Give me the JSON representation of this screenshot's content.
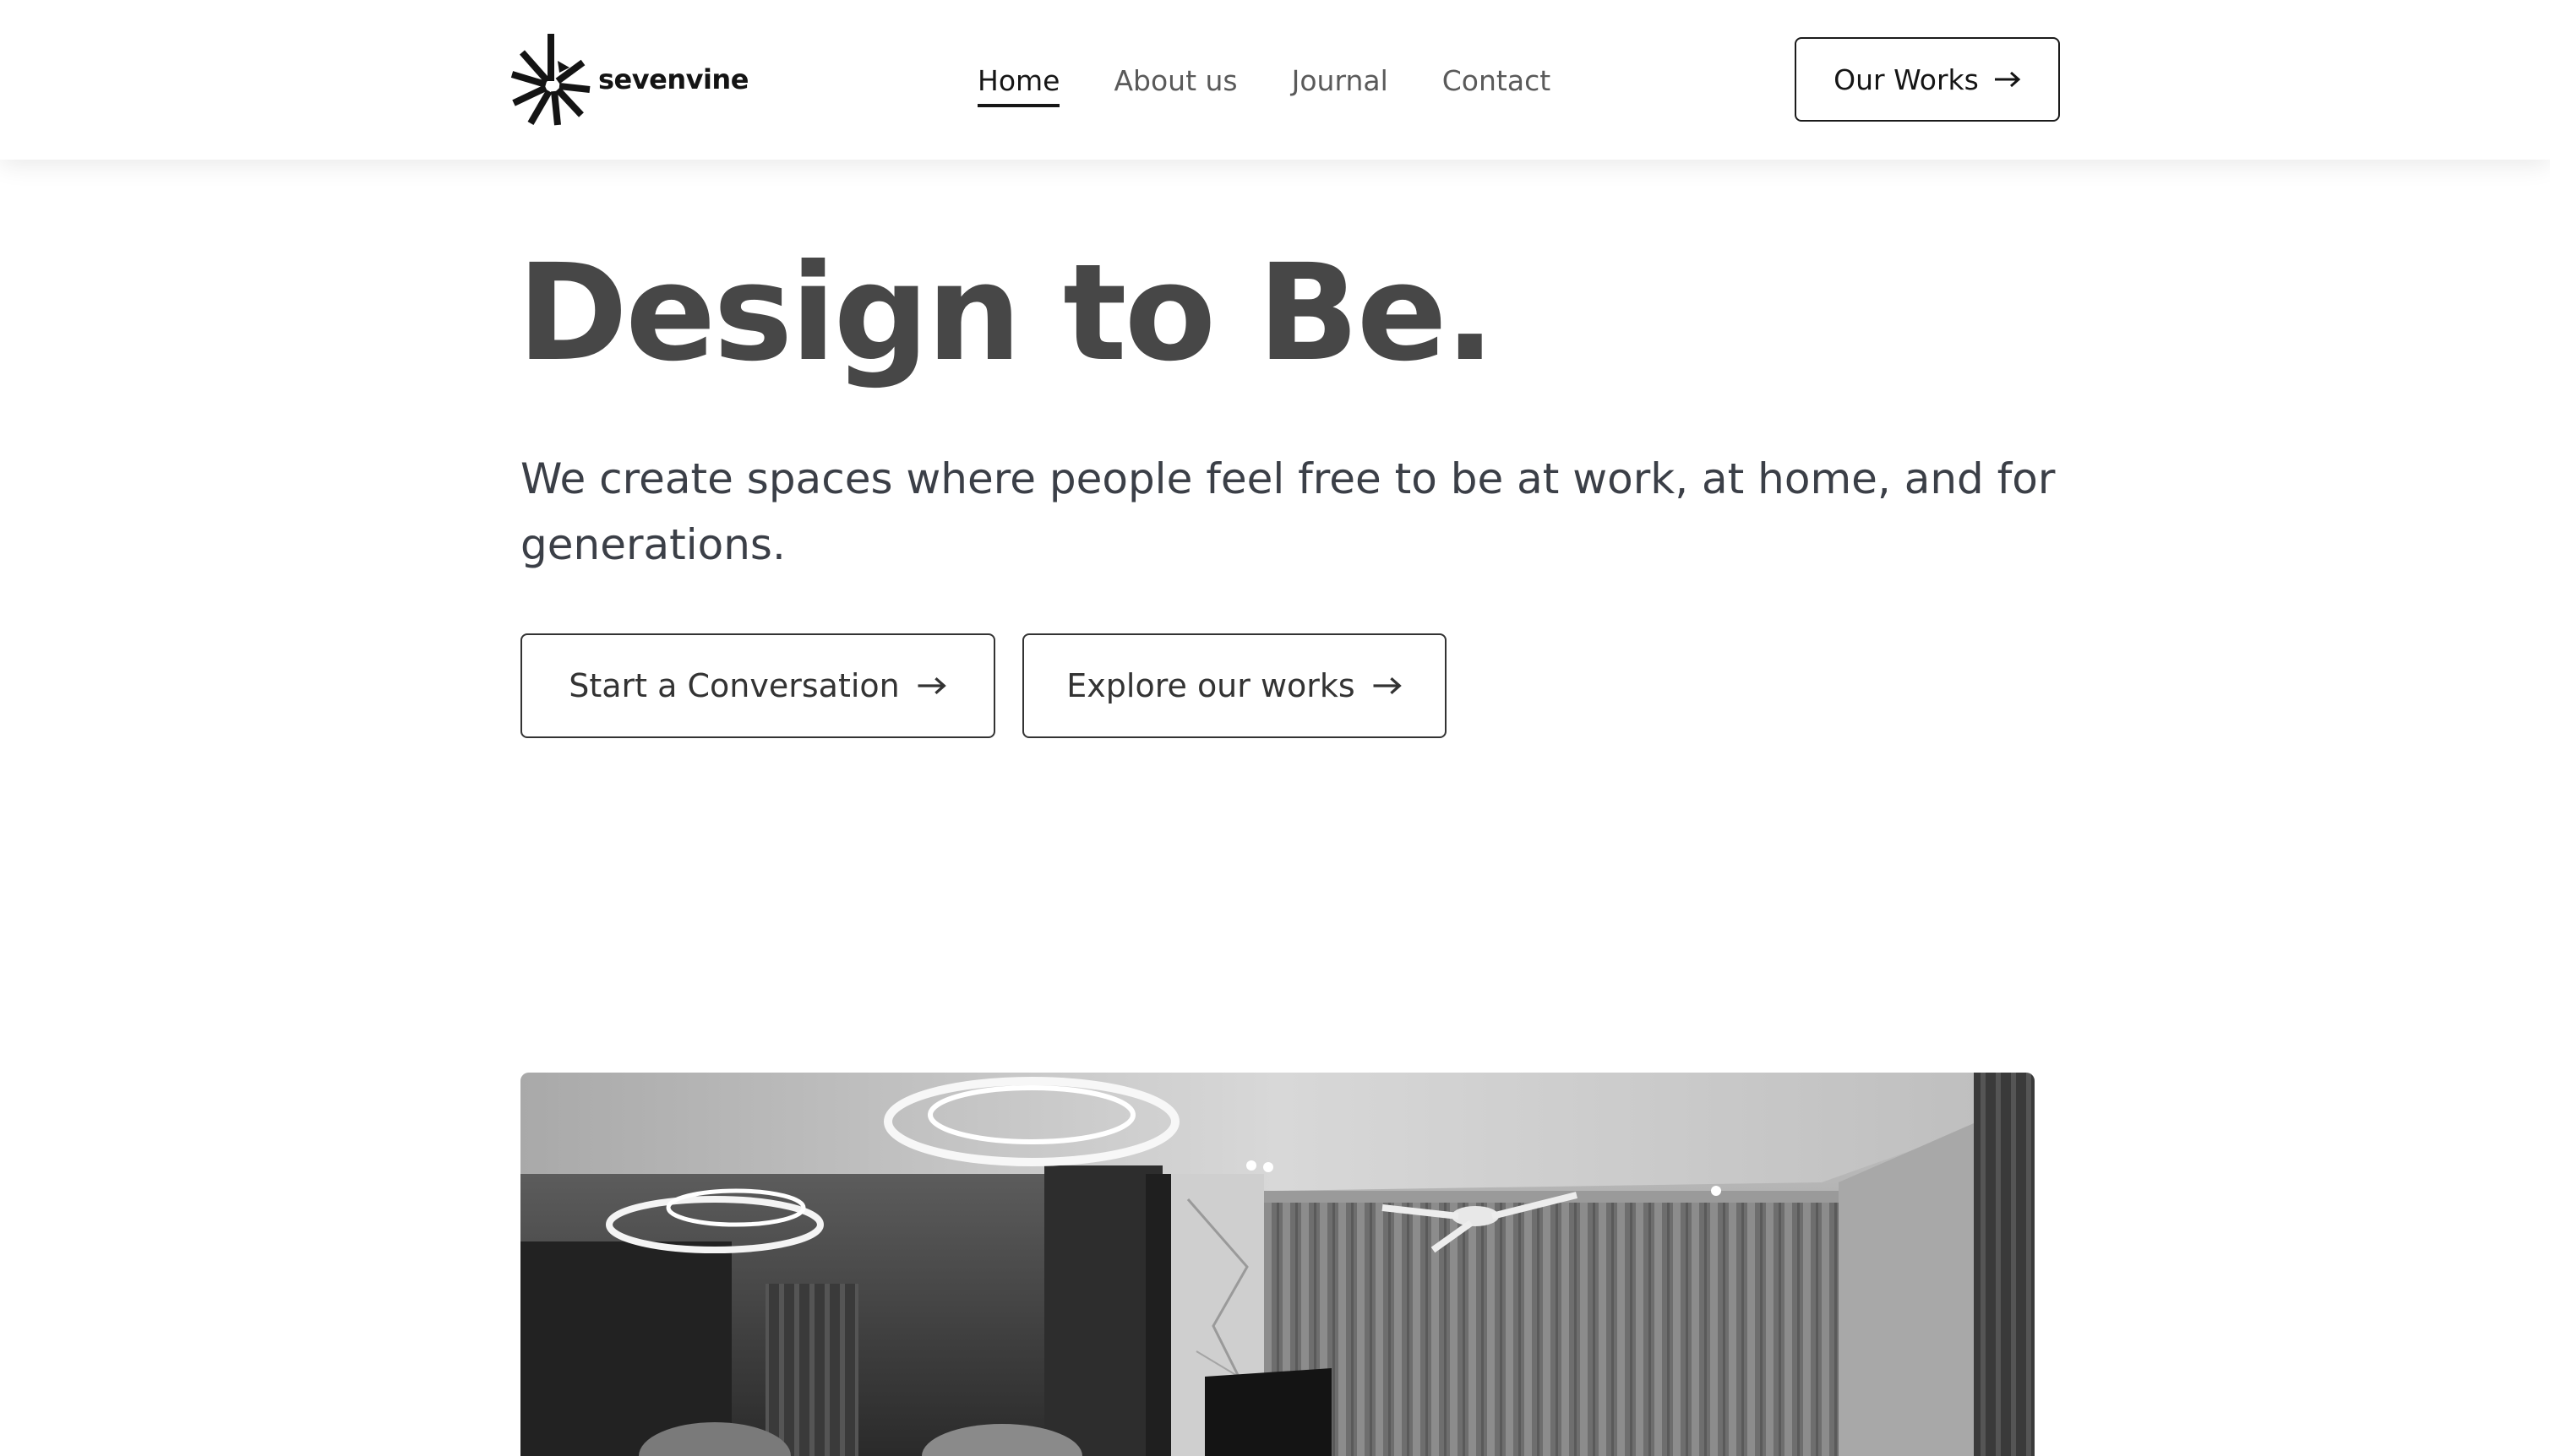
{
  "header": {
    "logo": {
      "text": "sevenvine",
      "icon": "starburst-logo-icon"
    },
    "nav": [
      {
        "label": "Home",
        "active": true
      },
      {
        "label": "About us",
        "active": false
      },
      {
        "label": "Journal",
        "active": false
      },
      {
        "label": "Contact",
        "active": false
      }
    ],
    "cta": {
      "label": "Our Works",
      "icon": "arrow-right-icon"
    }
  },
  "hero": {
    "title": "Design to Be.",
    "subtitle": "We create spaces where people feel free to be at work, at home, and for generations.",
    "buttons": [
      {
        "label": "Start a Conversation",
        "icon": "arrow-right-icon"
      },
      {
        "label": "Explore our works",
        "icon": "arrow-right-icon"
      }
    ],
    "image": {
      "subject": "grayscale interior photo of a living room with ring pendant lights and curtains"
    }
  },
  "colors": {
    "title": "#474747",
    "text": "#3b3f47",
    "border": "#333333",
    "background": "#ffffff"
  }
}
